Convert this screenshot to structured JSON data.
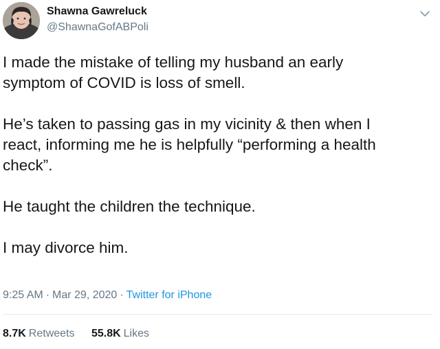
{
  "author": {
    "display_name": "Shawna Gawreluck",
    "handle": "@ShawnaGofABPoli",
    "avatar_icon": "user-avatar-photo"
  },
  "menu": {
    "icon": "chevron-down-icon"
  },
  "tweet": {
    "paragraphs": [
      "I made the mistake of telling my husband an early\nsymptom of COVID is loss of smell.",
      "He’s taken to passing gas in my vicinity & then when I\nreact, informing me he is helpfully “performing a health\ncheck”.",
      "He taught the children the technique.",
      "I may divorce him."
    ]
  },
  "meta": {
    "time": "9:25 AM",
    "date": "Mar 29, 2020",
    "separator": "·",
    "source": "Twitter for iPhone"
  },
  "stats": {
    "retweets_count": "8.7K",
    "retweets_label": "Retweets",
    "likes_count": "55.8K",
    "likes_label": "Likes"
  },
  "colors": {
    "text": "#14171a",
    "secondary": "#657786",
    "link": "#1b95e0",
    "divider": "#e6ecf0"
  }
}
